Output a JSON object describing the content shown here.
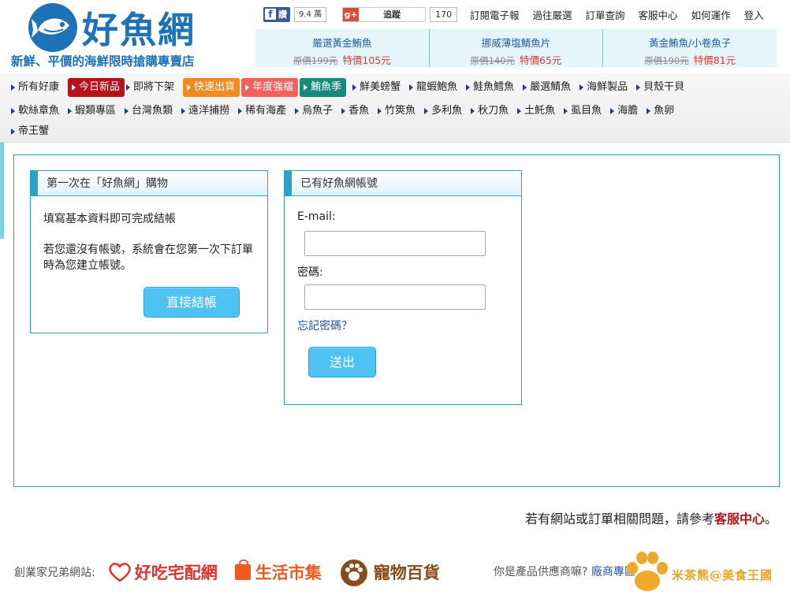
{
  "header": {
    "logo_text": "好魚網",
    "slogan": "新鮮、平價的海鮮限時搶購專賣店"
  },
  "social": {
    "fb_label": "讚",
    "fb_count": "9.4 萬",
    "gplus_label": "追蹤",
    "gplus_count": "170"
  },
  "topnav": [
    "訂閱電子報",
    "過往嚴選",
    "訂單查詢",
    "客服中心",
    "如何運作",
    "登入"
  ],
  "promos": [
    {
      "title": "嚴選黃金鮪魚",
      "old_price": "原價199元",
      "new_price": "特價105元"
    },
    {
      "title": "挪威薄塩鯖魚片",
      "old_price": "原價140元",
      "new_price": "特價65元"
    },
    {
      "title": "黃金鮪魚/小卷魚子",
      "old_price": "原價190元",
      "new_price": "特價81元"
    }
  ],
  "categories": {
    "row1": [
      "所有好康",
      "今日新品",
      "即將下架",
      "快速出貨",
      "年度強檔",
      "鮪魚季",
      "鮮美螃蟹",
      "龍蝦鮑魚",
      "鮭魚鱈魚",
      "嚴選鯖魚",
      "海鮮製品",
      "貝殼干貝"
    ],
    "row2": [
      "軟絲章魚",
      "蝦類專區",
      "台灣魚類",
      "遠洋捕撈",
      "稀有海產",
      "烏魚子",
      "香魚",
      "竹筴魚",
      "多利魚",
      "秋刀魚",
      "土魠魚",
      "虱目魚",
      "海膽",
      "魚卵"
    ],
    "row3": [
      "帝王蟹"
    ]
  },
  "guest_panel": {
    "title": "第一次在「好魚網」購物",
    "line1": "填寫基本資料即可完成結帳",
    "line2": "若您還沒有帳號，系統會在您第一次下訂單時為您建立帳號。",
    "button": "直接結帳"
  },
  "login_panel": {
    "title": "已有好魚網帳號",
    "email_label": "E-mail:",
    "email_value": "",
    "password_label": "密碼:",
    "password_value": "",
    "forgot": "忘記密碼？",
    "submit": "送出"
  },
  "help": {
    "text": "若有網站或訂單相關問題，請參考",
    "link": "客服中心",
    "suffix": "。"
  },
  "sister": {
    "label": "創業家兄弟網站:",
    "sites": [
      "好吃宅配網",
      "生活市集",
      "寵物百貨"
    ]
  },
  "supplier": {
    "text": "你是產品供應商嘛?",
    "link": "廠商專區"
  },
  "watermark": "米茶熊@美食王國",
  "colors": {
    "brand_blue": "#1d72b8",
    "accent_cyan": "#2aa1c6",
    "button_blue": "#4dc2f3",
    "price_red": "#e03a2e",
    "highlight_red": "#b8121b",
    "highlight_orange": "#f08a21",
    "highlight_salmon": "#f0625a",
    "highlight_teal": "#178a7b"
  }
}
